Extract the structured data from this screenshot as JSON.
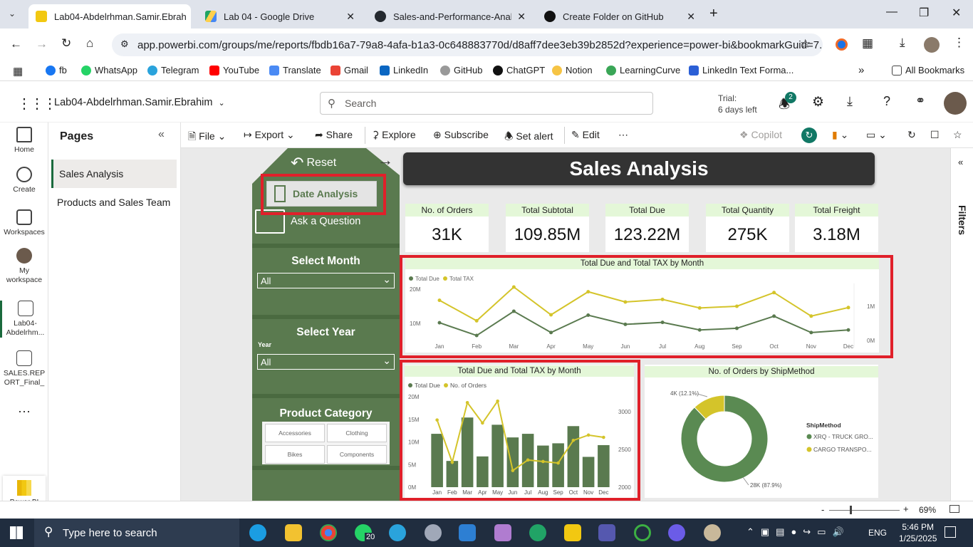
{
  "browser": {
    "tabs": [
      {
        "title": "Lab04-Abdelrhman.Samir.Ebrah",
        "active": true
      },
      {
        "title": "Lab 04 - Google Drive",
        "active": false
      },
      {
        "title": "Sales-and-Performance-Analysi",
        "active": false
      },
      {
        "title": "Create Folder on GitHub",
        "active": false
      }
    ],
    "url": "app.powerbi.com/groups/me/reports/fbdb16a7-79a8-4afa-b1a3-0c648883770d/d8aff7dee3eb39b2852d?experience=power-bi&bookmarkGuid=7...",
    "bookmarks": [
      "fb",
      "WhatsApp",
      "Telegram",
      "YouTube",
      "Translate",
      "Gmail",
      "LinkedIn",
      "GitHub",
      "ChatGPT",
      "Notion",
      "LearningCurve",
      "LinkedIn Text Forma..."
    ],
    "all_bookmarks": "All Bookmarks"
  },
  "pbi": {
    "report_name": "Lab04-Abdelrhman.Samir.Ebrahim",
    "search_placeholder": "Search",
    "trial_line1": "Trial:",
    "trial_line2": "6 days left",
    "notif_count": "2",
    "nav": [
      {
        "label": "Home"
      },
      {
        "label": "Create"
      },
      {
        "label": "Workspaces"
      },
      {
        "label": "My workspace"
      },
      {
        "label": "Lab04-Abdelrhm..."
      },
      {
        "label": "SALES.REPORT_Final_P..."
      }
    ],
    "brand": "Power BI",
    "pages_title": "Pages",
    "pages": [
      "Sales Analysis",
      "Products and Sales Team"
    ],
    "toolbar": {
      "file": "File",
      "export": "Export",
      "share": "Share",
      "explore": "Explore",
      "subscribe": "Subscribe",
      "alert": "Set alert",
      "edit": "Edit",
      "copilot": "Copilot"
    },
    "filters_label": "Filters",
    "zoom": "69%"
  },
  "report": {
    "reset": "Reset",
    "date_analysis": "Date Analysis",
    "ask": "Ask a Question",
    "select_month": "Select Month",
    "month_value": "All",
    "select_year": "Select Year",
    "year_label": "Year",
    "year_value": "All",
    "product_category": "Product Category",
    "categories": [
      "Accessories",
      "Clothing",
      "Bikes",
      "Components"
    ],
    "title": "Sales Analysis",
    "kpis": [
      {
        "label": "No. of Orders",
        "value": "31K"
      },
      {
        "label": "Total Subtotal",
        "value": "109.85M"
      },
      {
        "label": "Total Due",
        "value": "123.22M"
      },
      {
        "label": "Total Quantity",
        "value": "275K"
      },
      {
        "label": "Total Freight",
        "value": "3.18M"
      }
    ]
  },
  "chart_data": [
    {
      "type": "line",
      "title": "Total Due and Total TAX by Month",
      "categories": [
        "Jan",
        "Feb",
        "Mar",
        "Apr",
        "May",
        "Jun",
        "Jul",
        "Aug",
        "Sep",
        "Oct",
        "Nov",
        "Dec"
      ],
      "series": [
        {
          "name": "Total Due",
          "axis": "left",
          "color": "#5a7a4f",
          "values": [
            11.5,
            7.6,
            15.0,
            8.5,
            13.8,
            11.0,
            11.6,
            9.3,
            9.8,
            13.5,
            8.5,
            9.3
          ]
        },
        {
          "name": "Total TAX",
          "axis": "right",
          "color": "#d4c42a",
          "values": [
            0.94,
            0.46,
            1.25,
            0.6,
            1.14,
            0.9,
            0.96,
            0.76,
            0.8,
            1.12,
            0.57,
            0.77
          ]
        }
      ],
      "y_left_ticks": [
        "20M",
        "10M"
      ],
      "y_right_ticks": [
        "1M",
        "0M"
      ],
      "legend": "top-left"
    },
    {
      "type": "bar",
      "title": "Total Due and Total TAX by Month",
      "categories": [
        "Jan",
        "Feb",
        "Mar",
        "Apr",
        "May",
        "Jun",
        "Jul",
        "Aug",
        "Sep",
        "Oct",
        "Nov",
        "Dec"
      ],
      "series": [
        {
          "name": "Total Due",
          "kind": "bar",
          "color": "#5a7a4f",
          "values": [
            11.8,
            5.8,
            15.4,
            6.8,
            13.8,
            11.0,
            11.8,
            9.2,
            9.7,
            13.5,
            6.7,
            9.3
          ]
        },
        {
          "name": "No. of Orders",
          "kind": "line",
          "color": "#d4c42a",
          "values": [
            2890,
            2330,
            3120,
            2850,
            3140,
            2220,
            2360,
            2340,
            2320,
            2620,
            2690,
            2660
          ]
        }
      ],
      "y_left_ticks": [
        "20M",
        "15M",
        "10M",
        "5M",
        "0M"
      ],
      "y_right_ticks": [
        "3000",
        "2500",
        "2000"
      ],
      "legend": "top-left"
    },
    {
      "type": "pie",
      "title": "No. of Orders by ShipMethod",
      "legend_title": "ShipMethod",
      "slices": [
        {
          "name": "XRQ - TRUCK GRO...",
          "label": "28K (87.9%)",
          "value": 87.9,
          "color": "#5a8a52"
        },
        {
          "name": "CARGO TRANSPO...",
          "label": "4K (12.1%)",
          "value": 12.1,
          "color": "#d4c42a"
        }
      ]
    }
  ],
  "taskbar": {
    "search": "Type here to search",
    "badge": "20",
    "lang": "ENG",
    "time": "5:46 PM",
    "date": "1/25/2025"
  }
}
